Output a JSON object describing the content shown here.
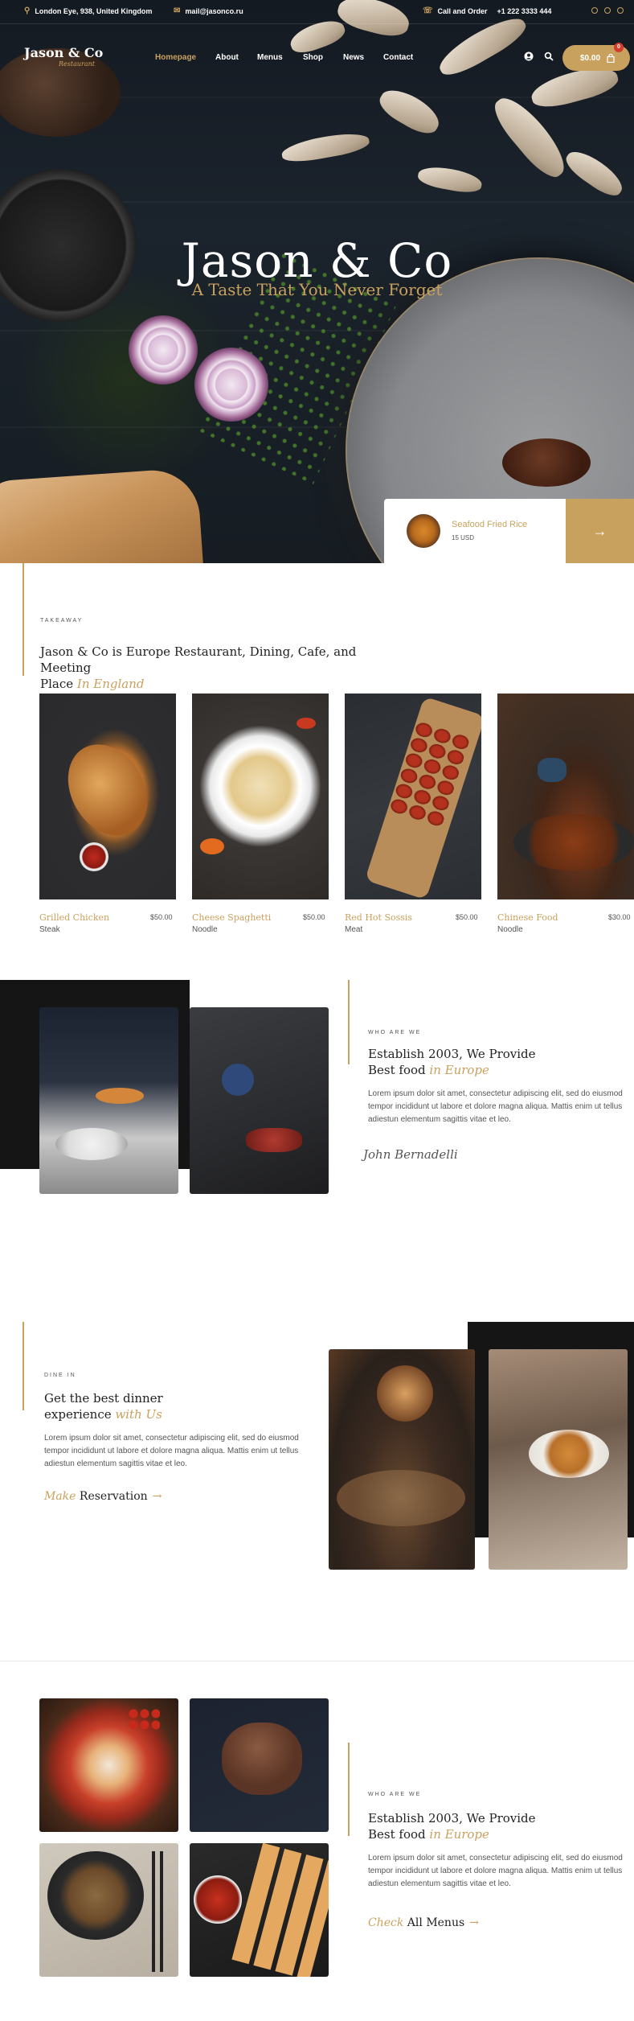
{
  "topbar": {
    "address": "London Eye, 938, United Kingdom",
    "email": "mail@jasonco.ru",
    "call_label": "Call and Order",
    "phone": "+1 222 3333 444"
  },
  "nav": {
    "logo": "Jason & Co",
    "logo_sub": "Restaurant",
    "items": [
      "Homepage",
      "About",
      "Menus",
      "Shop",
      "News",
      "Contact"
    ],
    "cart_total": "$0.00",
    "cart_count": "0"
  },
  "hero": {
    "title": "Jason & Co",
    "subtitle": "A Taste That You Never Forget",
    "promo_name": "Seafood Fried Rice",
    "promo_price": "15 USD",
    "promo_arrow": "→"
  },
  "takeaway": {
    "eyebrow": "TAKEAWAY",
    "heading_line1": "Jason & Co is Europe Restaurant, Dining, Cafe, and Meeting",
    "heading_line2": "Place",
    "heading_em": "In England",
    "items": [
      {
        "name": "Grilled Chicken",
        "price": "$50.00",
        "category": "Steak"
      },
      {
        "name": "Cheese Spaghetti",
        "price": "$50.00",
        "category": "Noodle"
      },
      {
        "name": "Red Hot Sossis",
        "price": "$50.00",
        "category": "Meat"
      },
      {
        "name": "Chinese Food",
        "price": "$30.00",
        "category": "Noodle"
      }
    ]
  },
  "about": {
    "eyebrow": "WHO ARE WE",
    "heading_line1": "Establish 2003, We Provide",
    "heading_line2": "Best food",
    "heading_em": "in Europe",
    "body": "Lorem ipsum dolor sit amet, consectetur adipiscing elit, sed do eiusmod tempor incididunt ut labore et dolore magna aliqua. Mattis enim ut tellus adiestun elementum sagittis vitae et leo.",
    "signature": "John Bernadelli"
  },
  "dine": {
    "eyebrow": "DINE IN",
    "heading_line1": "Get the best dinner",
    "heading_line2": "experience",
    "heading_em": "with Us",
    "body": "Lorem ipsum dolor sit amet, consectetur adipiscing elit, sed do eiusmod tempor incididunt ut labore et dolore magna aliqua. Mattis enim ut tellus adiestun elementum sagittis vitae et leo.",
    "cta_em": "Make",
    "cta_text": "Reservation",
    "cta_arrow": "→"
  },
  "menus": {
    "eyebrow": "WHO ARE WE",
    "heading_line1": "Establish 2003, We Provide",
    "heading_line2": "Best food",
    "heading_em": "in Europe",
    "body": "Lorem ipsum dolor sit amet, consectetur adipiscing elit, sed do eiusmod tempor incididunt ut labore et dolore magna aliqua. Mattis enim ut tellus adiestun elementum sagittis vitae et leo.",
    "cta_em": "Check",
    "cta_text": "All Menus",
    "cta_arrow": "→"
  },
  "colors": {
    "accent": "#c9a15e",
    "dark": "#151515",
    "text": "#222222",
    "muted": "#555555"
  },
  "icons": [
    "location-icon",
    "mail-icon",
    "phone-icon",
    "facebook-icon",
    "twitter-icon",
    "instagram-icon",
    "user-icon",
    "search-icon",
    "bag-icon",
    "arrow-right-icon"
  ]
}
